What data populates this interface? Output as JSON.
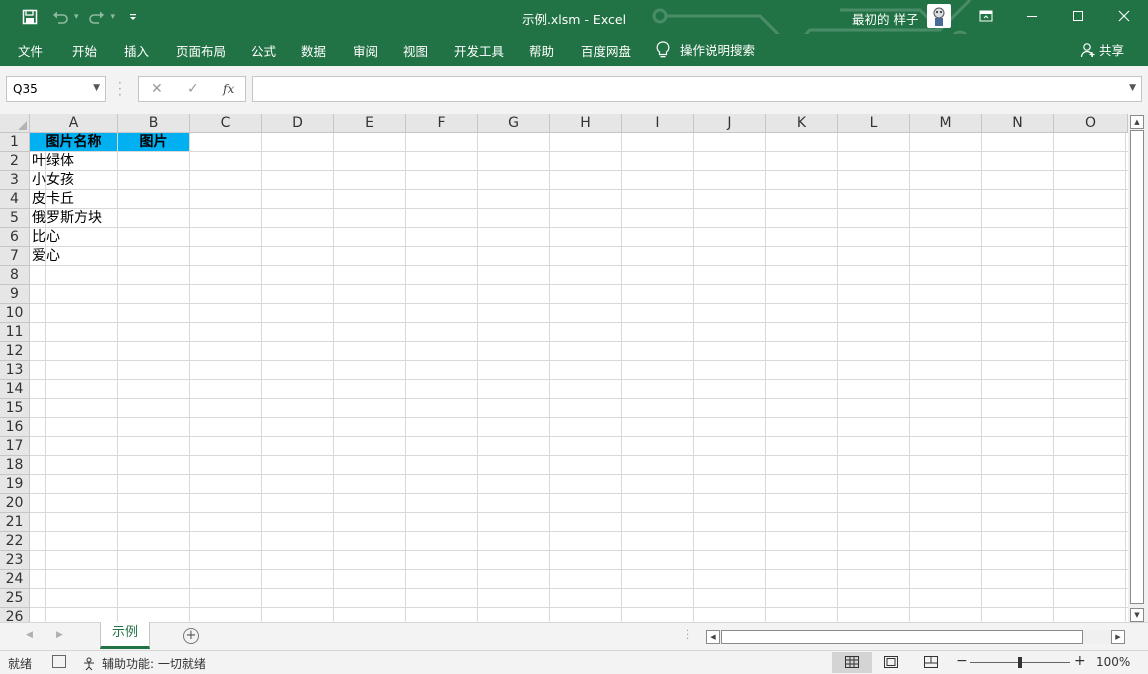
{
  "window": {
    "title": "示例.xlsm  -  Excel",
    "user": "最初的 样子",
    "accent_color": "#217346"
  },
  "ribbon": {
    "tabs": [
      "文件",
      "开始",
      "插入",
      "页面布局",
      "公式",
      "数据",
      "审阅",
      "视图",
      "开发工具",
      "帮助",
      "百度网盘"
    ],
    "tell_me": "操作说明搜索",
    "share": "共享"
  },
  "formula_bar": {
    "name_box": "Q35",
    "fx": "fx",
    "formula": ""
  },
  "grid": {
    "columns": [
      "A",
      "B",
      "C",
      "D",
      "E",
      "F",
      "G",
      "H",
      "I",
      "J",
      "K",
      "L",
      "M",
      "N",
      "O"
    ],
    "rows": [
      "1",
      "2",
      "3",
      "4",
      "5",
      "6",
      "7",
      "8",
      "9",
      "10",
      "11",
      "12",
      "13",
      "14",
      "15",
      "16",
      "17",
      "18",
      "19",
      "20",
      "21",
      "22",
      "23",
      "24",
      "25",
      "26"
    ],
    "header_fill": "#00b0f0",
    "cells": {
      "A1": "图片名称",
      "B1": "图片",
      "A2": "叶绿体",
      "A3": "小女孩",
      "A4": "皮卡丘",
      "A5": "俄罗斯方块",
      "A6": "比心",
      "A7": "爱心"
    }
  },
  "sheets": {
    "tabs": [
      "示例"
    ],
    "active": "示例"
  },
  "status": {
    "ready": "就绪",
    "accessibility": "辅助功能: 一切就绪",
    "zoom": "100%"
  }
}
